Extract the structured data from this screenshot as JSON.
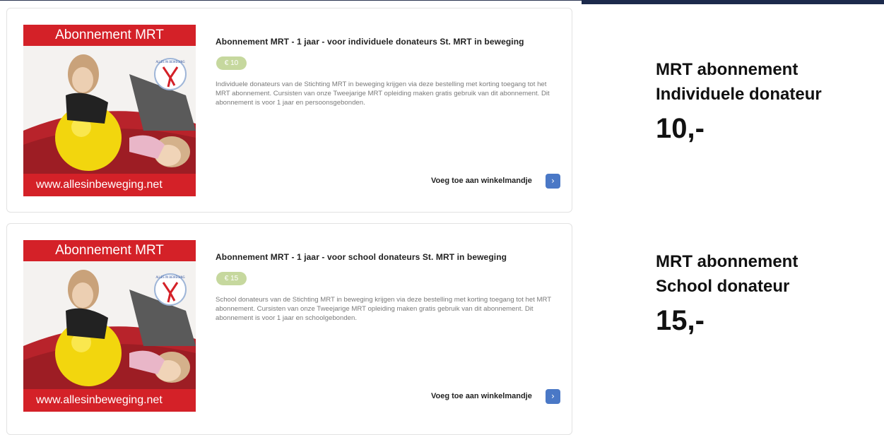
{
  "products": [
    {
      "image": {
        "header": "Abonnement MRT",
        "footer": "www.allesinbeweging.net",
        "logo_text": "ALLES IN BEWEGING"
      },
      "title": "Abonnement MRT - 1 jaar - voor individuele donateurs St. MRT in beweging",
      "price_badge": "€ 10",
      "description": "Individuele donateurs van de Stichting MRT in beweging krijgen via deze bestelling met korting toegang tot het MRT abonnement. Cursisten van onze Tweejarige MRT opleiding maken gratis gebruik van dit abonnement. Dit abonnement is voor 1 jaar en persoonsgebonden.",
      "add_to_cart": "Voeg toe aan winkelmandje",
      "arrow_icon": "chevron-right-icon"
    },
    {
      "image": {
        "header": "Abonnement MRT",
        "footer": "www.allesinbeweging.net",
        "logo_text": "ALLES IN BEWEGING"
      },
      "title": "Abonnement MRT - 1 jaar - voor school donateurs St. MRT in beweging",
      "price_badge": "€ 15",
      "description": "School donateurs van de Stichting MRT in beweging krijgen via deze bestelling met korting toegang tot het MRT abonnement. Cursisten van onze Tweejarige MRT opleiding maken gratis gebruik van dit abonnement. Dit abonnement is voor 1 jaar en schoolgebonden.",
      "add_to_cart": "Voeg toe aan winkelmandje",
      "arrow_icon": "chevron-right-icon"
    }
  ],
  "annotations": [
    {
      "line1": "MRT abonnement",
      "line2": "Individuele donateur",
      "price": "10,-"
    },
    {
      "line1": "MRT abonnement",
      "line2": "School donateur",
      "price": "15,-"
    }
  ],
  "colors": {
    "brand_red": "#d42128",
    "price_badge": "#c6d89e",
    "button_blue": "#4a78c6",
    "top_bar": "#1c2a4c"
  }
}
